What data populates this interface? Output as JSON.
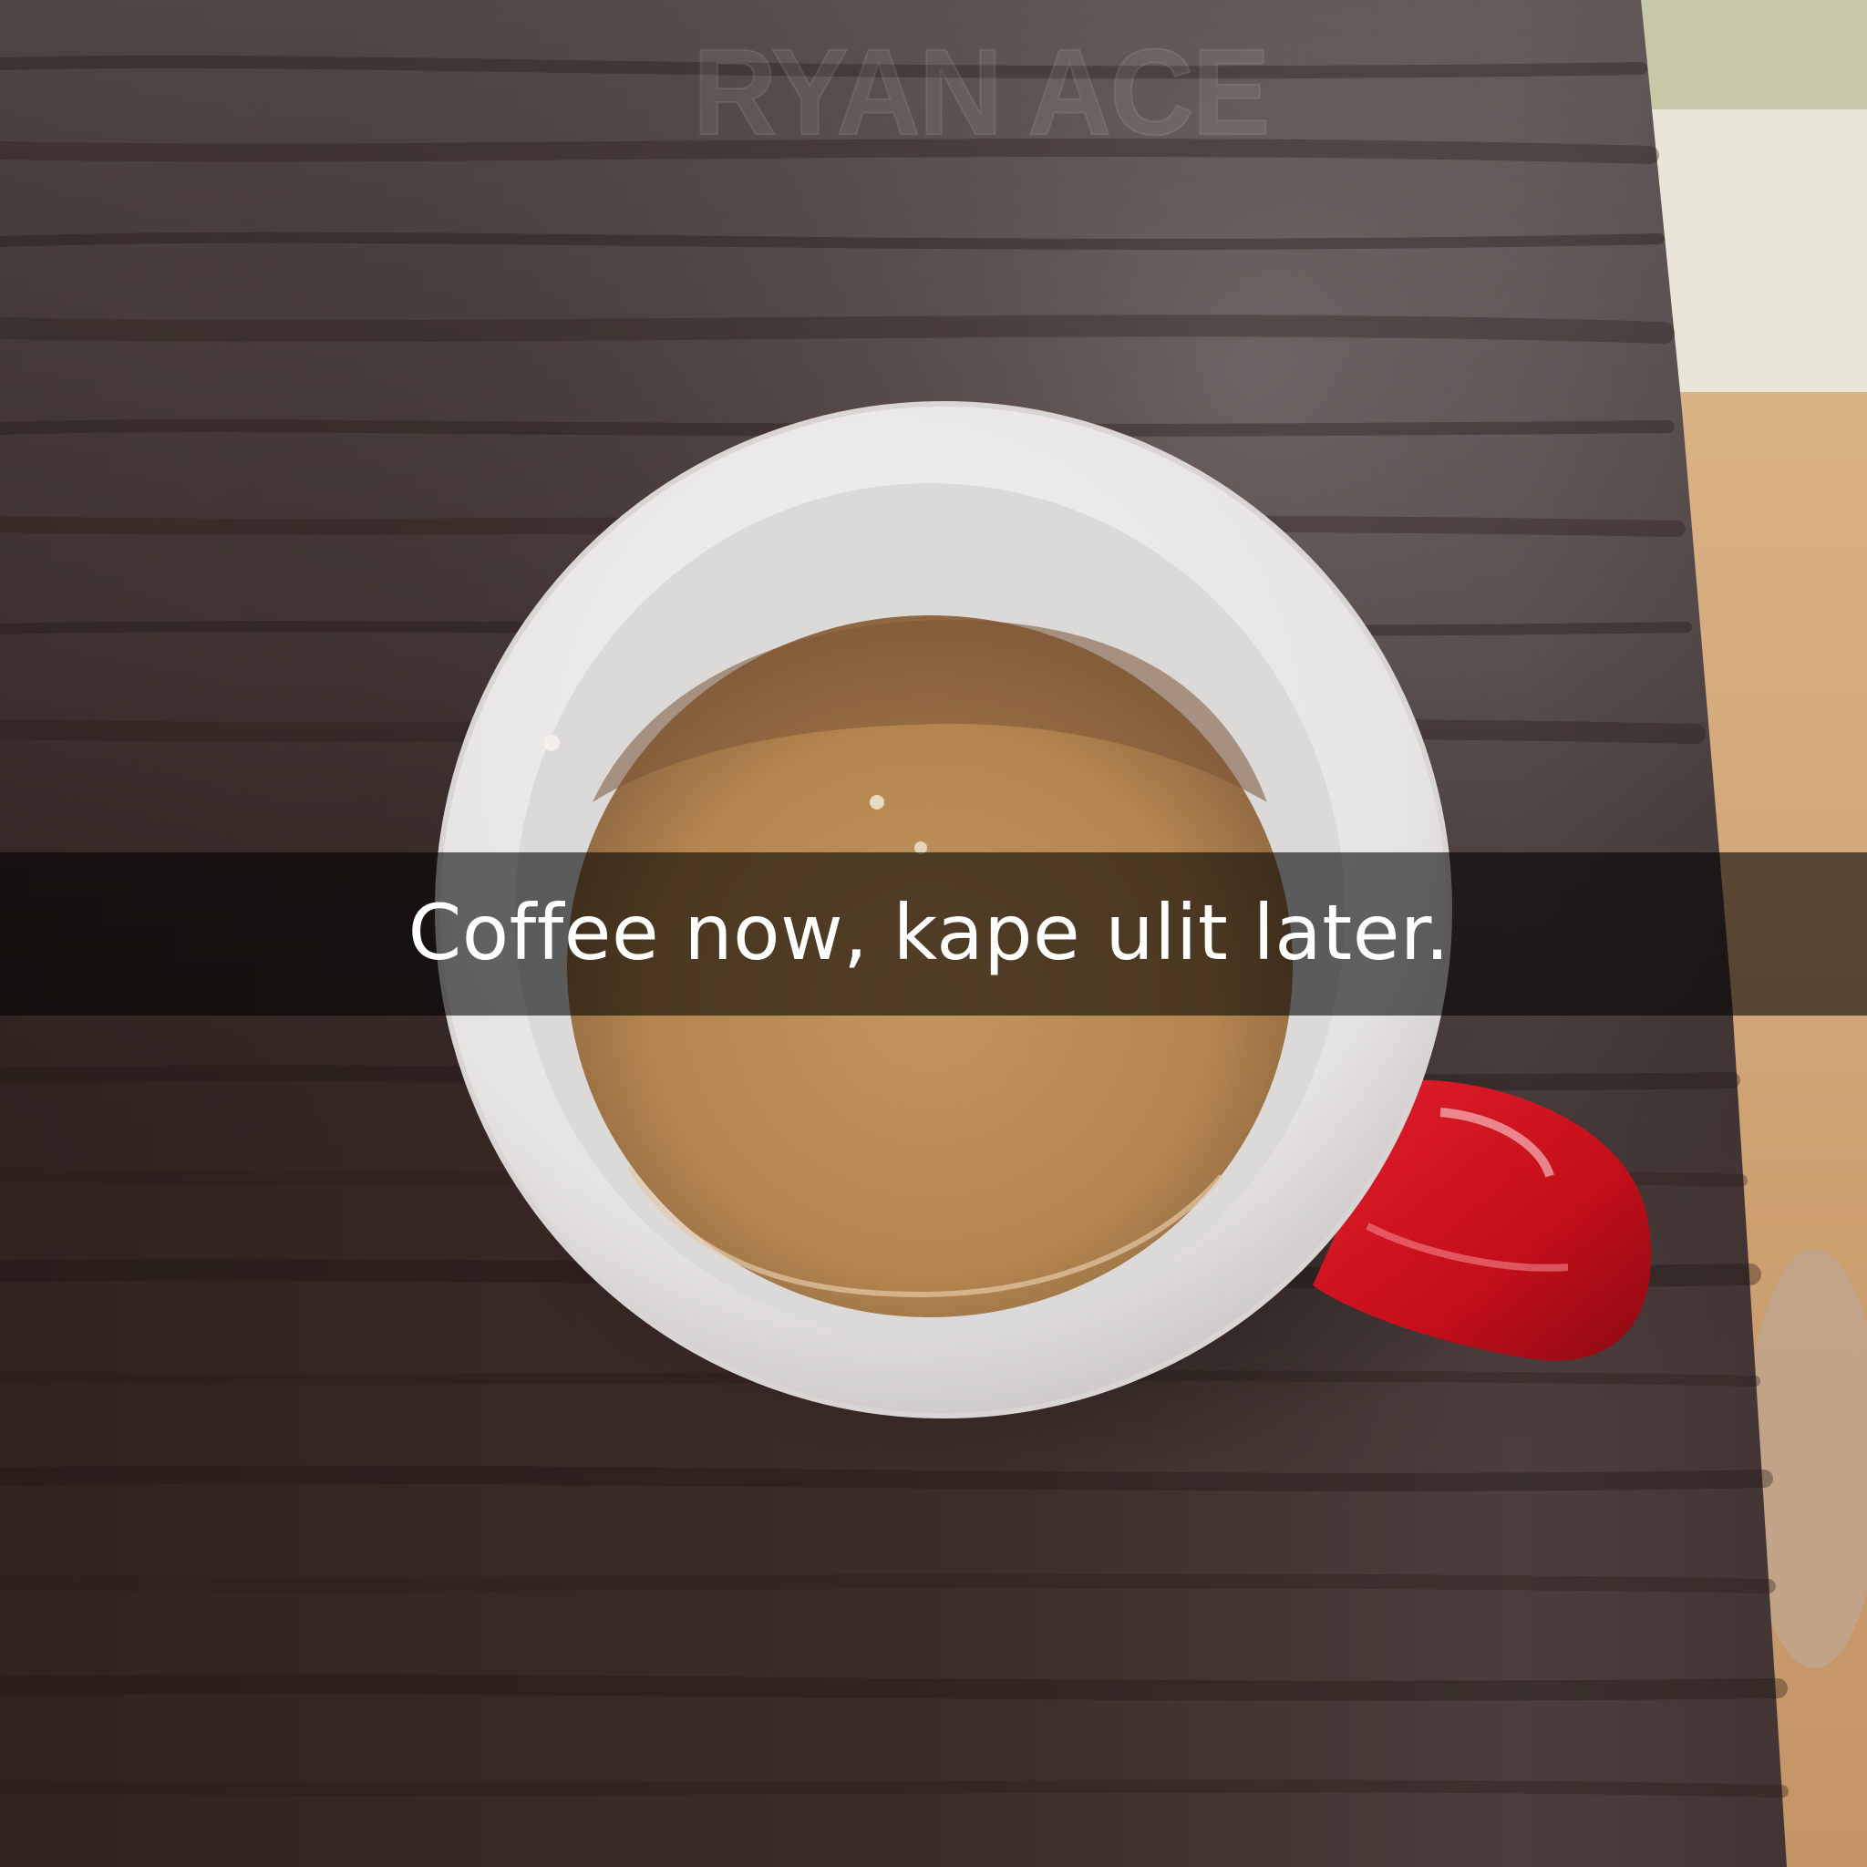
{
  "watermark": {
    "text": "RYAN ACE"
  },
  "caption": {
    "text": "Coffee now, kape ulit later."
  },
  "scene": {
    "subject": "coffee-mug",
    "surface": "dark-wood-table",
    "colors": {
      "table": "#3a2a26",
      "mug_rim": "#e9e7e6",
      "coffee": "#b38453",
      "handle": "#c8111d",
      "floor": "#d2a676",
      "caption_bar": "#000000"
    }
  }
}
